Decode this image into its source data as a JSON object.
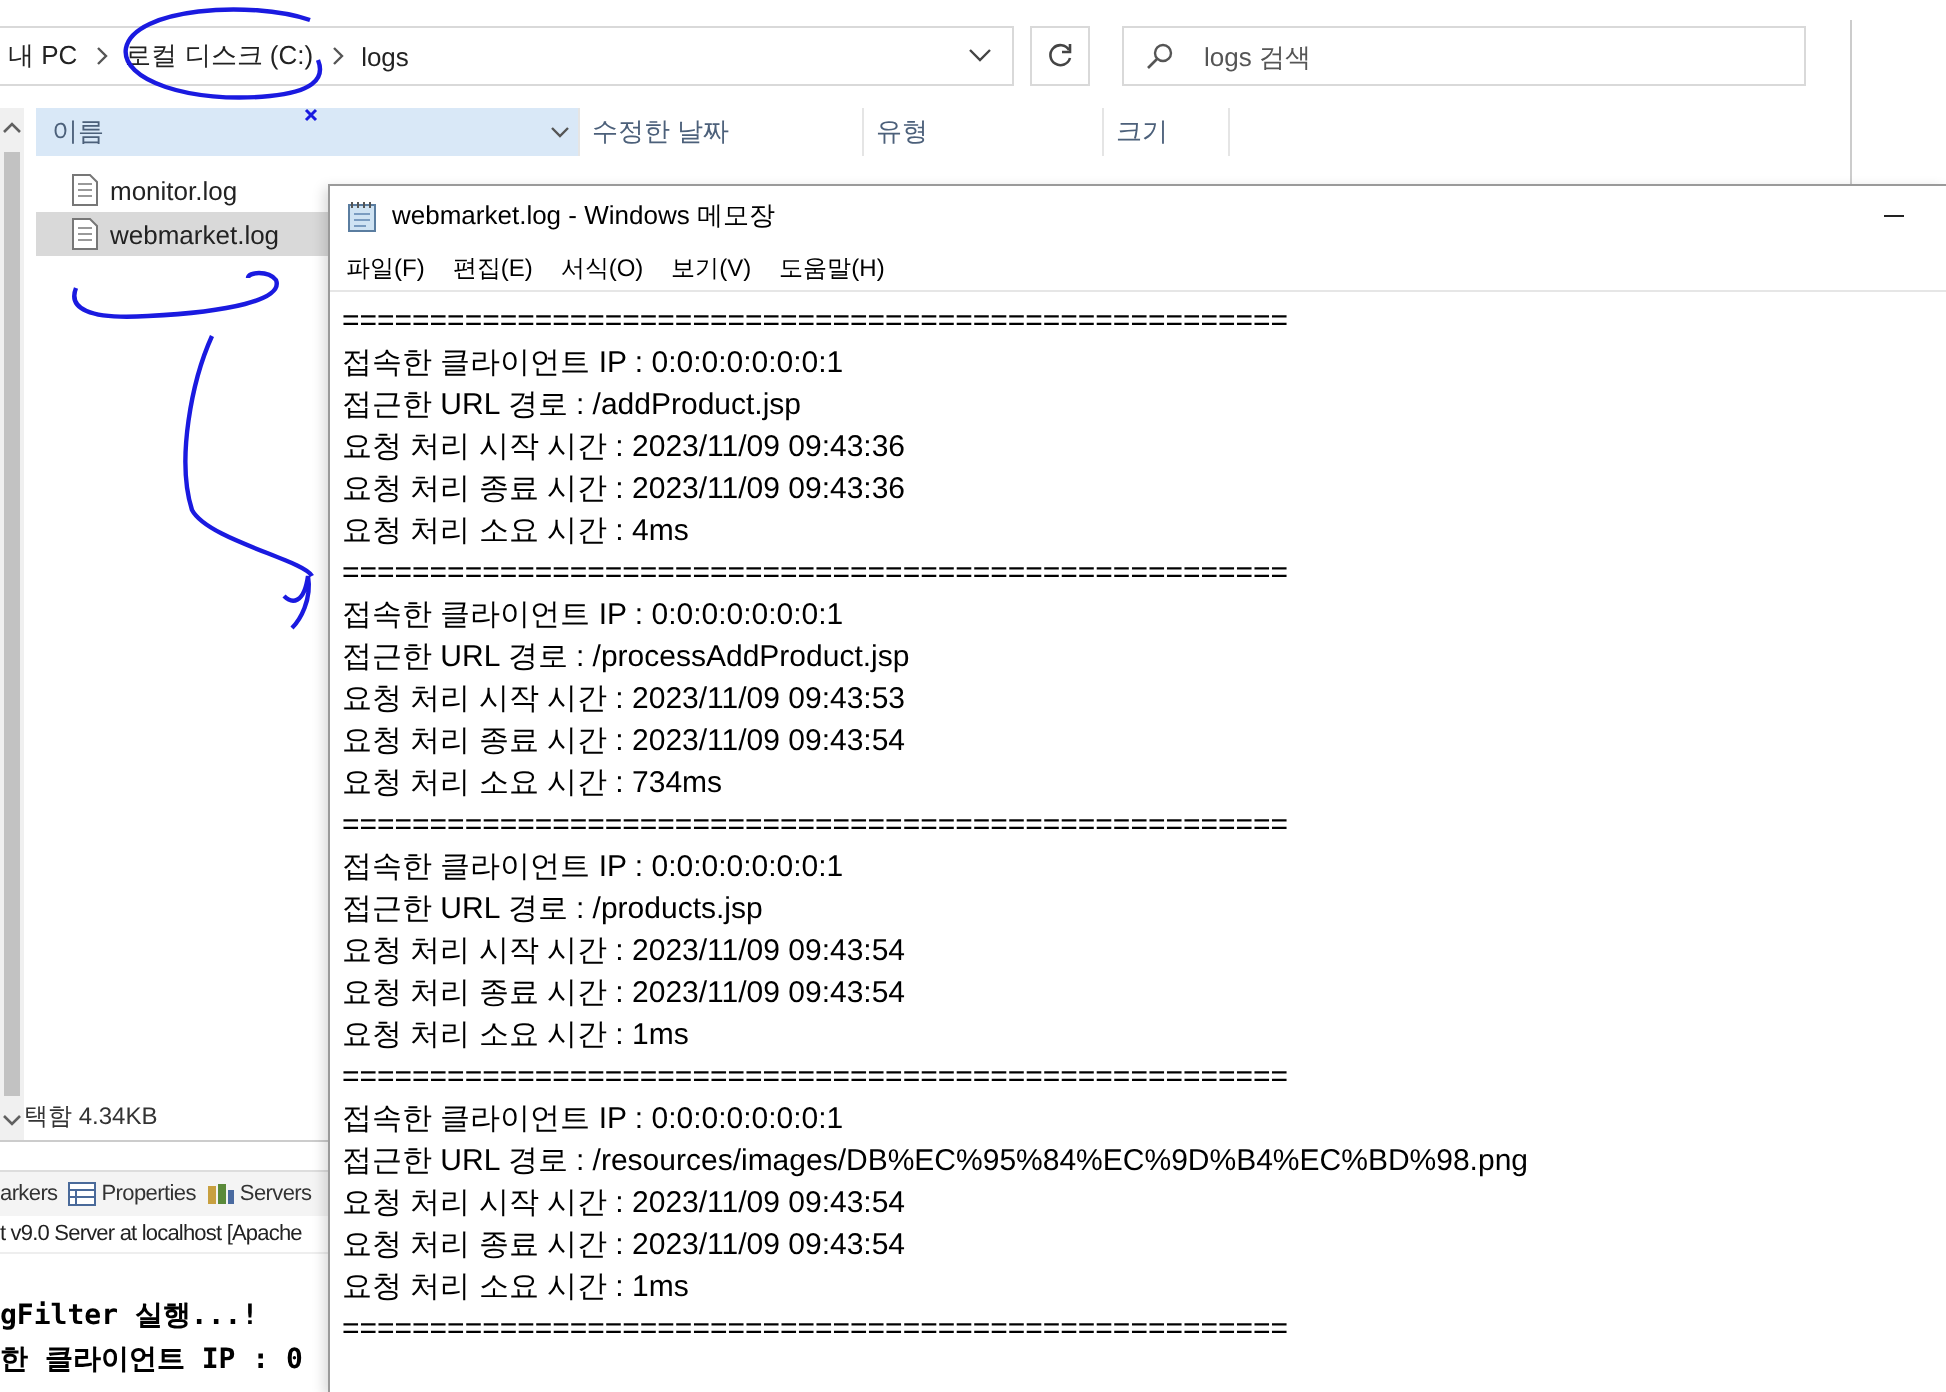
{
  "explorer": {
    "breadcrumb": [
      "내 PC",
      "로컬 디스크 (C:)",
      "logs"
    ],
    "search": {
      "placeholder": "logs 검색"
    },
    "columns": [
      {
        "label": "이름",
        "selected": true
      },
      {
        "label": "수정한 날짜",
        "selected": false
      },
      {
        "label": "유형",
        "selected": false
      },
      {
        "label": "크기",
        "selected": false
      }
    ],
    "files": [
      {
        "name": "monitor.log",
        "selected": false
      },
      {
        "name": "webmarket.log",
        "selected": true
      }
    ],
    "status": "택함 4.34KB"
  },
  "eclipse": {
    "tabs": [
      "arkers",
      "Properties",
      "Servers"
    ],
    "console_title": "t v9.0 Server at localhost [Apache",
    "console_lines": [
      "gFilter 실행...!",
      "한 클라이언트 IP : 0"
    ]
  },
  "notepad": {
    "title": "webmarket.log - Windows 메모장",
    "menu": [
      "파일(F)",
      "편집(E)",
      "서식(O)",
      "보기(V)",
      "도움말(H)"
    ],
    "lines": [
      "======================================================",
      "접속한 클라이언트 IP : 0:0:0:0:0:0:0:1",
      "접근한 URL 경로 : /addProduct.jsp",
      "요청 처리 시작 시간 : 2023/11/09 09:43:36",
      "요청 처리 종료 시간 : 2023/11/09 09:43:36",
      "요청 처리 소요 시간 : 4ms",
      "======================================================",
      "접속한 클라이언트 IP : 0:0:0:0:0:0:0:1",
      "접근한 URL 경로 : /processAddProduct.jsp",
      "요청 처리 시작 시간 : 2023/11/09 09:43:53",
      "요청 처리 종료 시간 : 2023/11/09 09:43:54",
      "요청 처리 소요 시간 : 734ms",
      "======================================================",
      "접속한 클라이언트 IP : 0:0:0:0:0:0:0:1",
      "접근한 URL 경로 : /products.jsp",
      "요청 처리 시작 시간 : 2023/11/09 09:43:54",
      "요청 처리 종료 시간 : 2023/11/09 09:43:54",
      "요청 처리 소요 시간 : 1ms",
      "======================================================",
      "접속한 클라이언트 IP : 0:0:0:0:0:0:0:1",
      "접근한 URL 경로 : /resources/images/DB%EC%95%84%EC%9D%B4%EC%BD%98.png",
      "요청 처리 시작 시간 : 2023/11/09 09:43:54",
      "요청 처리 종료 시간 : 2023/11/09 09:43:54",
      "요청 처리 소요 시간 : 1ms",
      "======================================================"
    ]
  }
}
